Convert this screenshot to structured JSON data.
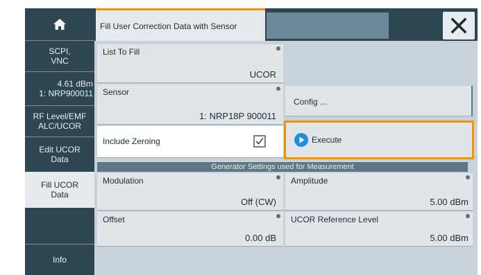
{
  "sidebar": {
    "items": [
      {
        "name": "home",
        "icon": "home-icon"
      },
      {
        "line1": "SCPI,",
        "line2": "VNC"
      },
      {
        "line1": "4.61 dBm",
        "line2": "1: NRP900011"
      },
      {
        "line1": "RF Level/EMF",
        "line2": "ALC/UCOR"
      },
      {
        "line1": "Edit UCOR",
        "line2": "Data"
      },
      {
        "line1": "Fill UCOR",
        "line2": "Data"
      },
      {
        "line1": "",
        "line2": ""
      },
      {
        "line1": "Info",
        "line2": ""
      }
    ]
  },
  "titlebar": {
    "tab_label": "Fill User Correction Data with Sensor",
    "close_icon": "close-icon"
  },
  "form": {
    "list_to_fill": {
      "label": "List To Fill",
      "value": "UCOR"
    },
    "sensor": {
      "label": "Sensor",
      "value": "1: NRP18P 900011"
    },
    "config_button": "Config ...",
    "include_zeroing": {
      "label": "Include Zeroing",
      "checked": true
    },
    "execute_button": "Execute",
    "section_title": "Generator Settings used for Measurement",
    "modulation": {
      "label": "Modulation",
      "value": "Off (CW)"
    },
    "amplitude": {
      "label": "Amplitude",
      "value": "5.00 dBm"
    },
    "offset": {
      "label": "Offset",
      "value": "0.00 dB"
    },
    "ucor_reference_level": {
      "label": "UCOR Reference Level",
      "value": "5.00 dBm"
    }
  },
  "colors": {
    "accent": "#f29200",
    "sidebar_bg": "#2e4652",
    "execute_icon": "#1f8fe0"
  }
}
